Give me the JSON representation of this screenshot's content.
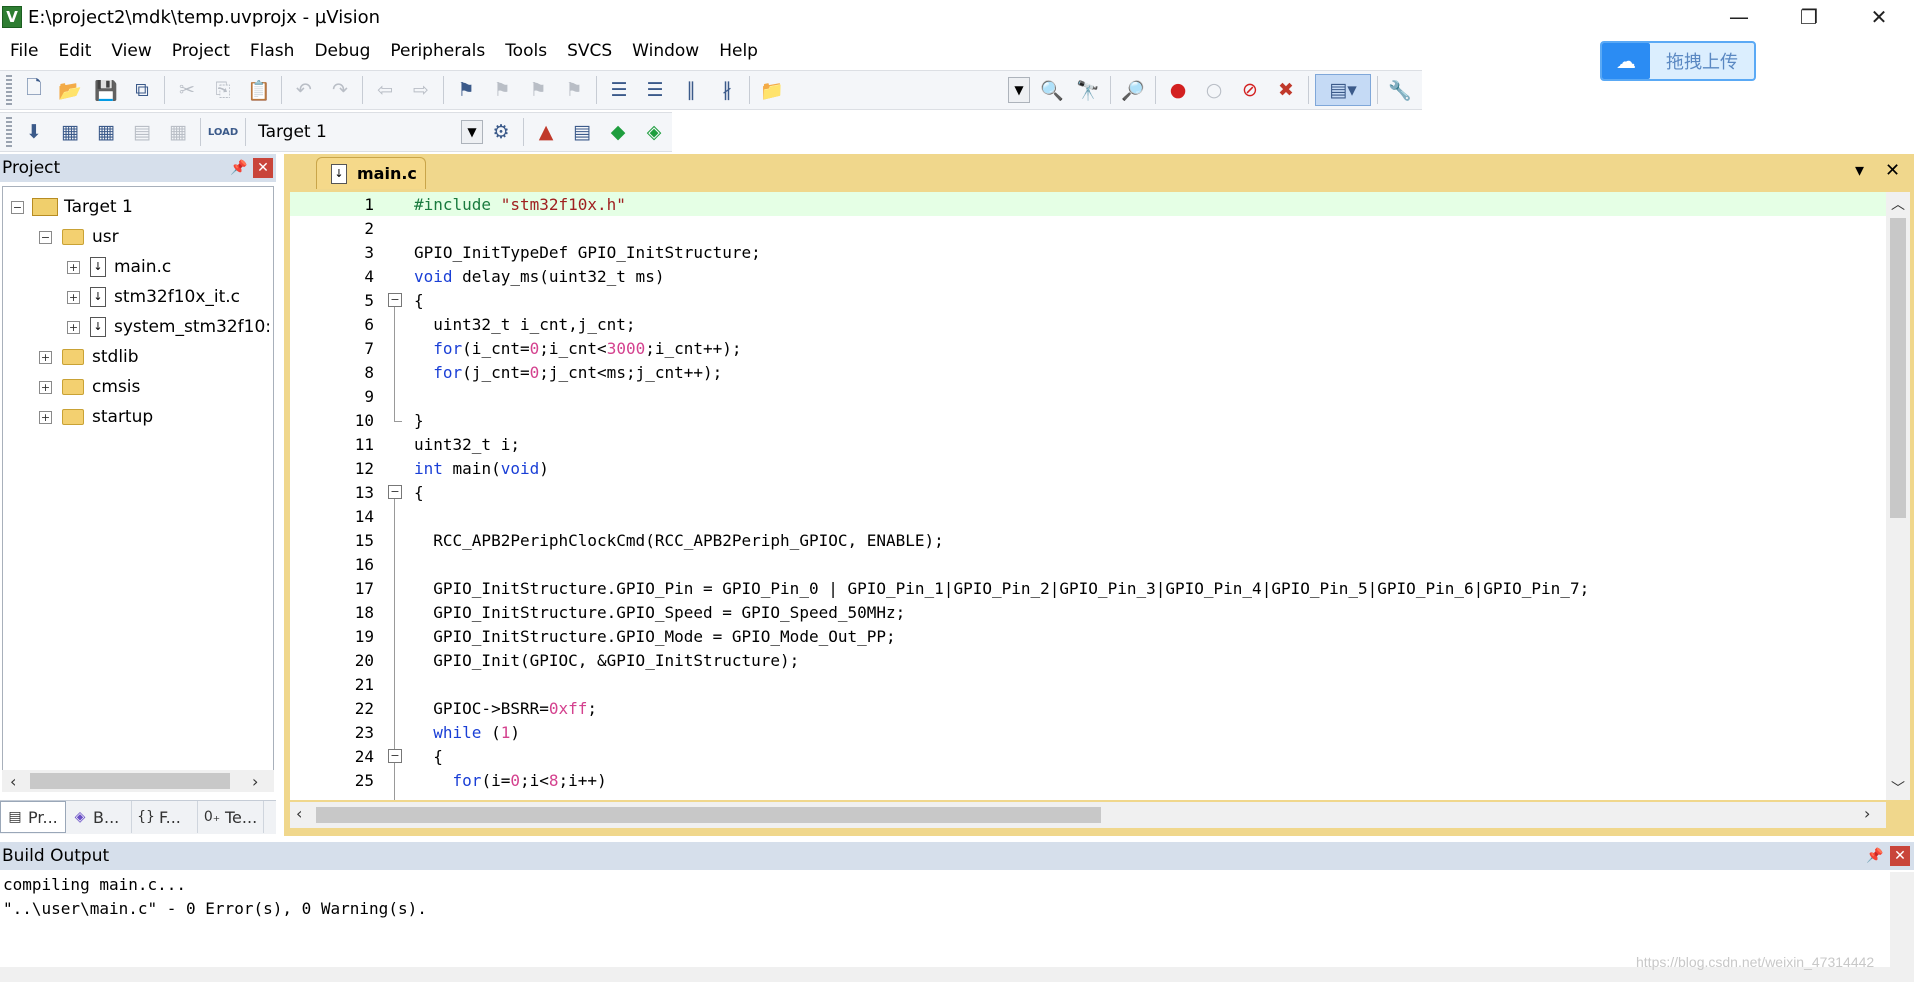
{
  "window": {
    "title": "E:\\project2\\mdk\\temp.uvprojx - µVision",
    "app_icon": "V",
    "controls": {
      "minimize": "—",
      "restore": "❐",
      "close": "✕"
    }
  },
  "menu": [
    "File",
    "Edit",
    "View",
    "Project",
    "Flash",
    "Debug",
    "Peripherals",
    "Tools",
    "SVCS",
    "Window",
    "Help"
  ],
  "upload_widget": {
    "label": "拖拽上传",
    "icon": "cloud-icon"
  },
  "toolbar2": {
    "target": "Target 1",
    "load_label": "LOAD"
  },
  "project_panel": {
    "title": "Project",
    "tree": {
      "root": "Target 1",
      "groups": [
        {
          "name": "usr",
          "files": [
            "main.c",
            "stm32f10x_it.c",
            "system_stm32f10:"
          ]
        },
        {
          "name": "stdlib"
        },
        {
          "name": "cmsis"
        },
        {
          "name": "startup"
        }
      ]
    },
    "tabs": [
      "Pr...",
      "B...",
      "F...",
      "Te..."
    ]
  },
  "editor": {
    "tab": "main.c",
    "lines": [
      "1",
      "2",
      "3",
      "4",
      "5",
      "6",
      "7",
      "8",
      "9",
      "10",
      "11",
      "12",
      "13",
      "14",
      "15",
      "16",
      "17",
      "18",
      "19",
      "20",
      "21",
      "22",
      "23",
      "24",
      "25"
    ]
  },
  "build_output": {
    "title": "Build Output",
    "lines": [
      "compiling main.c...",
      "\"..\\user\\main.c\" - 0 Error(s), 0 Warning(s)."
    ]
  },
  "watermark": "https://blog.csdn.net/weixin_47314442"
}
